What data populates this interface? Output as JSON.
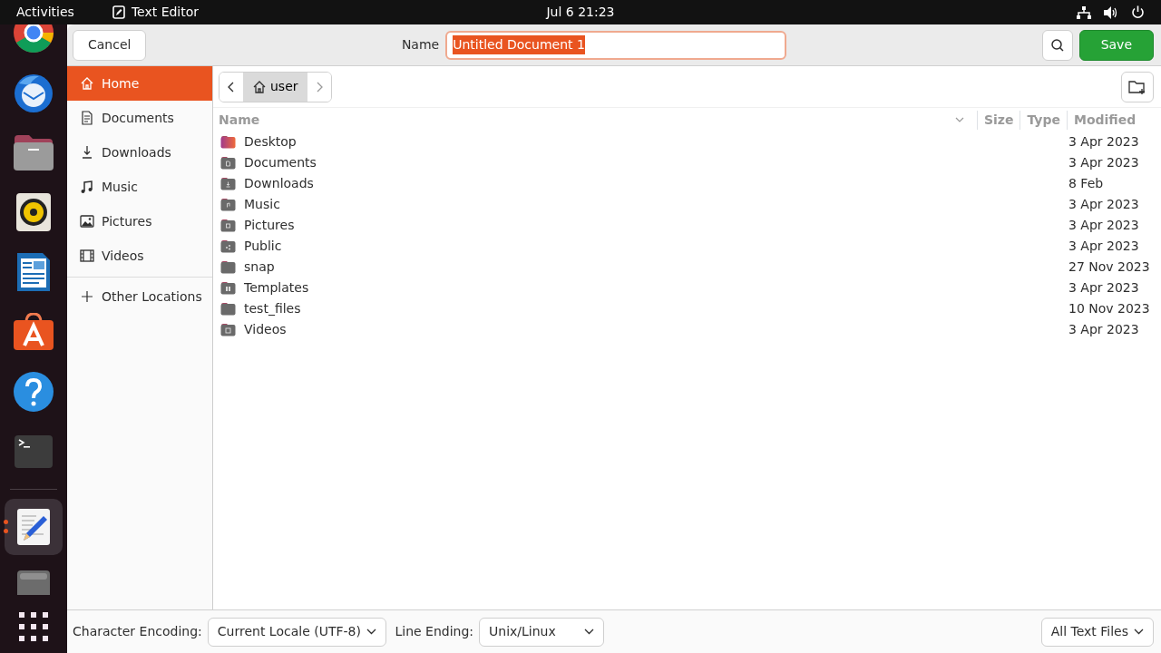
{
  "top_bar": {
    "activities": "Activities",
    "app_title": "Text Editor",
    "clock": "Jul 6  21:23"
  },
  "dock": [
    {
      "kind": "browser",
      "running": false,
      "selected": false
    },
    {
      "kind": "mail",
      "running": false,
      "selected": false
    },
    {
      "kind": "files",
      "running": false,
      "selected": false
    },
    {
      "kind": "speaker",
      "running": false,
      "selected": false
    },
    {
      "kind": "writer",
      "running": false,
      "selected": false
    },
    {
      "kind": "store",
      "running": false,
      "selected": false
    },
    {
      "kind": "help",
      "running": false,
      "selected": false
    },
    {
      "kind": "terminal",
      "running": false,
      "selected": false
    },
    {
      "kind": "editor",
      "running": true,
      "selected": true
    },
    {
      "kind": "drive",
      "running": false,
      "selected": false
    }
  ],
  "header": {
    "cancel": "Cancel",
    "name_label": "Name",
    "name_value": "Untitled Document 1",
    "name_text_selected": true,
    "save": "Save"
  },
  "sidebar": {
    "items": [
      {
        "label": "Home",
        "kind": "home",
        "selected": true
      },
      {
        "label": "Documents",
        "kind": "document",
        "selected": false
      },
      {
        "label": "Downloads",
        "kind": "download",
        "selected": false
      },
      {
        "label": "Music",
        "kind": "music",
        "selected": false
      },
      {
        "label": "Pictures",
        "kind": "picture",
        "selected": false
      },
      {
        "label": "Videos",
        "kind": "film",
        "selected": false
      }
    ],
    "other": {
      "label": "Other Locations",
      "kind": "plus",
      "selected": false
    }
  },
  "path_bar": {
    "segments": [
      {
        "label": "user",
        "selected": true
      }
    ]
  },
  "table": {
    "columns": [
      "Name",
      "Size",
      "Type",
      "Modified"
    ],
    "rows": [
      {
        "name": "Desktop",
        "kind": "desktop",
        "modified": "3 Apr 2023"
      },
      {
        "name": "Documents",
        "kind": "documents",
        "modified": "3 Apr 2023"
      },
      {
        "name": "Downloads",
        "kind": "downloads",
        "modified": "8 Feb"
      },
      {
        "name": "Music",
        "kind": "music",
        "modified": "3 Apr 2023"
      },
      {
        "name": "Pictures",
        "kind": "pictures",
        "modified": "3 Apr 2023"
      },
      {
        "name": "Public",
        "kind": "public",
        "modified": "3 Apr 2023"
      },
      {
        "name": "snap",
        "kind": "plain",
        "modified": "27 Nov 2023"
      },
      {
        "name": "Templates",
        "kind": "templates",
        "modified": "3 Apr 2023"
      },
      {
        "name": "test_files",
        "kind": "plain",
        "modified": "10 Nov 2023"
      },
      {
        "name": "Videos",
        "kind": "videos",
        "modified": "3 Apr 2023"
      }
    ]
  },
  "footer": {
    "encoding_label": "Character Encoding:",
    "encoding_value": "Current Locale (UTF-8)",
    "line_ending_label": "Line Ending:",
    "line_ending_value": "Unix/Linux",
    "filter": "All Text Files"
  }
}
